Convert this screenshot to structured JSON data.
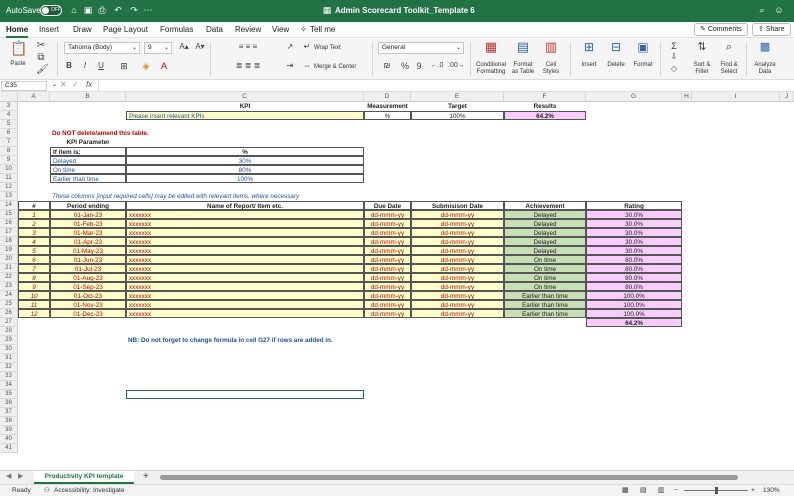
{
  "titlebar": {
    "autosave": "AutoSave",
    "toggle": "OFF",
    "title": "Admin Scorecard Toolkit_Template 6"
  },
  "menu": {
    "tabs": [
      "Home",
      "Insert",
      "Draw",
      "Page Layout",
      "Formulas",
      "Data",
      "Review",
      "View"
    ],
    "tell_me": "Tell me",
    "comments": "Comments",
    "share": "Share"
  },
  "ribbon": {
    "paste": "Paste",
    "font_name": "Tahoma (Body)",
    "font_size": "9",
    "wrap_text": "Wrap Text",
    "merge_center": "Merge & Center",
    "number_format": "General",
    "conditional_formatting": "Conditional Formatting",
    "format_as_table": "Format as Table",
    "cell_styles": "Cell Styles",
    "insert": "Insert",
    "delete": "Delete",
    "format": "Format",
    "sort_filter": "Sort & Filter",
    "find_select": "Find & Select",
    "analyze_data": "Analyze Data"
  },
  "formula": {
    "name_box": "C35",
    "fx": "fx"
  },
  "columns": [
    "A",
    "B",
    "C",
    "D",
    "E",
    "F",
    "G",
    "H",
    "I",
    "J"
  ],
  "rows": [
    "3",
    "4",
    "5",
    "6",
    "7",
    "8",
    "9",
    "10",
    "11",
    "12",
    "13",
    "14",
    "15",
    "16",
    "17",
    "18",
    "19",
    "20",
    "21",
    "22",
    "23",
    "24",
    "25",
    "26",
    "27",
    "28",
    "29",
    "30",
    "31",
    "32",
    "33",
    "34",
    "35",
    "36",
    "37",
    "38",
    "39",
    "40",
    "41"
  ],
  "kpi": {
    "h_kpi": "KPI",
    "h_measurement": "Measurement",
    "h_target": "Target",
    "h_results": "Results",
    "instruction": "Please insert relevant KPIs",
    "measurement": "%",
    "target": "100%",
    "result": "64.2%"
  },
  "warning": "Do NOT delete/amend this table.",
  "param": {
    "title": "KPI Parameter",
    "h1": "If item is:",
    "h2": "%",
    "rows": [
      [
        "Delayed",
        "30%"
      ],
      [
        "On time",
        "80%"
      ],
      [
        "Earlier than time",
        "100%"
      ]
    ]
  },
  "note": "These columns [input required cells] may be edited with relevant items, where necessary",
  "table": {
    "headers": [
      "#",
      "Period ending",
      "Name of Report/ Item etc.",
      "Due Date",
      "Submisison Date",
      "Achievement",
      "Rating"
    ],
    "rows": [
      [
        "1",
        "01-Jan-23",
        "xxxxxxx",
        "dd-mmm-yy",
        "dd-mmm-yy",
        "Delayed",
        "30.0%"
      ],
      [
        "2",
        "01-Feb-23",
        "xxxxxxx",
        "dd-mmm-yy",
        "dd-mmm-yy",
        "Delayed",
        "30.0%"
      ],
      [
        "3",
        "01-Mar-23",
        "xxxxxxx",
        "dd-mmm-yy",
        "dd-mmm-yy",
        "Delayed",
        "30.0%"
      ],
      [
        "4",
        "01-Apr-23",
        "xxxxxxx",
        "dd-mmm-yy",
        "dd-mmm-yy",
        "Delayed",
        "30.0%"
      ],
      [
        "5",
        "01-May-23",
        "xxxxxxx",
        "dd-mmm-yy",
        "dd-mmm-yy",
        "Delayed",
        "30.0%"
      ],
      [
        "6",
        "01-Jun-23",
        "xxxxxxx",
        "dd-mmm-yy",
        "dd-mmm-yy",
        "On time",
        "80.0%"
      ],
      [
        "7",
        "01-Jul-23",
        "xxxxxxx",
        "dd-mmm-yy",
        "dd-mmm-yy",
        "On time",
        "80.0%"
      ],
      [
        "8",
        "01-Aug-23",
        "xxxxxxx",
        "dd-mmm-yy",
        "dd-mmm-yy",
        "On time",
        "80.0%"
      ],
      [
        "9",
        "01-Sep-23",
        "xxxxxxx",
        "dd-mmm-yy",
        "dd-mmm-yy",
        "On time",
        "80.0%"
      ],
      [
        "10",
        "01-Oct-23",
        "xxxxxxx",
        "dd-mmm-yy",
        "dd-mmm-yy",
        "Earlier than time",
        "100.0%"
      ],
      [
        "11",
        "01-Nov-23",
        "xxxxxxx",
        "dd-mmm-yy",
        "dd-mmm-yy",
        "Earlier than time",
        "100.0%"
      ],
      [
        "12",
        "01-Dec-23",
        "xxxxxxx",
        "dd-mmm-yy",
        "dd-mmm-yy",
        "Earlier than time",
        "100.0%"
      ]
    ],
    "total": "64.2%"
  },
  "nb": "NB: Do not forget to change formula in cell G27 if rows are added in.",
  "sheet_tab": "Productivity KPI template",
  "status": {
    "ready": "Ready",
    "accessibility": "Accessibility: Investigate",
    "zoom": "130%"
  },
  "colors": {
    "brand": "#217346",
    "yellow": "#ffffcc",
    "pink": "#f9ccff",
    "green": "#c6dfb4"
  }
}
